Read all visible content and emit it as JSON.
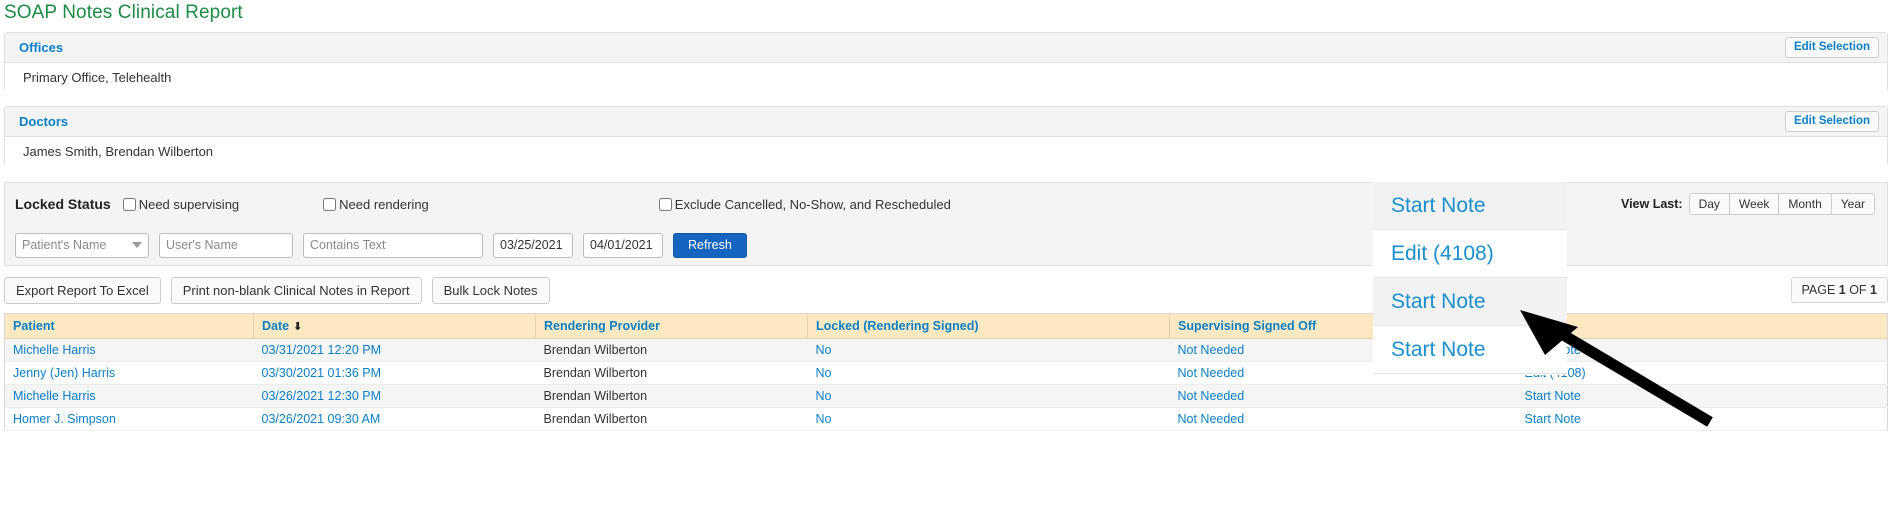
{
  "page": {
    "title": "SOAP Notes Clinical Report",
    "title_color": "#1c8b45"
  },
  "offices_panel": {
    "heading": "Offices",
    "value": "Primary Office, Telehealth",
    "edit_button": "Edit Selection"
  },
  "doctors_panel": {
    "heading": "Doctors",
    "value": "James Smith, Brendan Wilberton",
    "edit_button": "Edit Selection"
  },
  "filters": {
    "locked_status_label": "Locked Status",
    "need_supervising": "Need supervising",
    "need_rendering": "Need rendering",
    "exclude_cancelled": "Exclude Cancelled, No-Show, and Rescheduled",
    "view_last_label": "View Last:",
    "view_last_options": [
      "Day",
      "Week",
      "Month",
      "Year"
    ],
    "patient_name_placeholder": "Patient's Name",
    "user_name_placeholder": "User's Name",
    "contains_text_placeholder": "Contains Text",
    "date_from": "03/25/2021",
    "date_to": "04/01/2021",
    "refresh_button": "Refresh"
  },
  "actions": {
    "export_excel": "Export Report To Excel",
    "print_notes": "Print non-blank Clinical Notes in Report",
    "bulk_lock": "Bulk Lock Notes",
    "page_of": "PAGE 1 OF 1",
    "page_of_prefix": "PAGE ",
    "page_current": "1",
    "page_mid": " OF ",
    "page_total": "1"
  },
  "table": {
    "columns": [
      "Patient",
      "Date",
      "Rendering Provider",
      "Locked (Rendering Signed)",
      "Supervising Signed Off",
      ""
    ],
    "sort_column": "Date",
    "sort_direction_icon": "arrow-down",
    "rows": [
      {
        "patient": "Michelle Harris",
        "date": "03/31/2021 12:20 PM",
        "rendering_provider": "Brendan Wilberton",
        "locked": "No",
        "supervising_signed_off": "Not Needed",
        "action": "Start Note"
      },
      {
        "patient": "Jenny (Jen) Harris",
        "date": "03/30/2021 01:36 PM",
        "rendering_provider": "Brendan Wilberton",
        "locked": "No",
        "supervising_signed_off": "Not Needed",
        "action": "Edit (4108)"
      },
      {
        "patient": "Michelle Harris",
        "date": "03/26/2021 12:30 PM",
        "rendering_provider": "Brendan Wilberton",
        "locked": "No",
        "supervising_signed_off": "Not Needed",
        "action": "Start Note"
      },
      {
        "patient": "Homer J. Simpson",
        "date": "03/26/2021 09:30 AM",
        "rendering_provider": "Brendan Wilberton",
        "locked": "No",
        "supervising_signed_off": "Not Needed",
        "action": "Start Note"
      }
    ]
  },
  "magnifier": {
    "rows": [
      "Start Note",
      "Edit (4108)",
      "Start Note",
      "Start Note"
    ]
  },
  "colors": {
    "link": "#0b7fc7",
    "title_green": "#1c8b45",
    "table_header_bg": "#fce9c2",
    "primary_button": "#1565c0"
  }
}
